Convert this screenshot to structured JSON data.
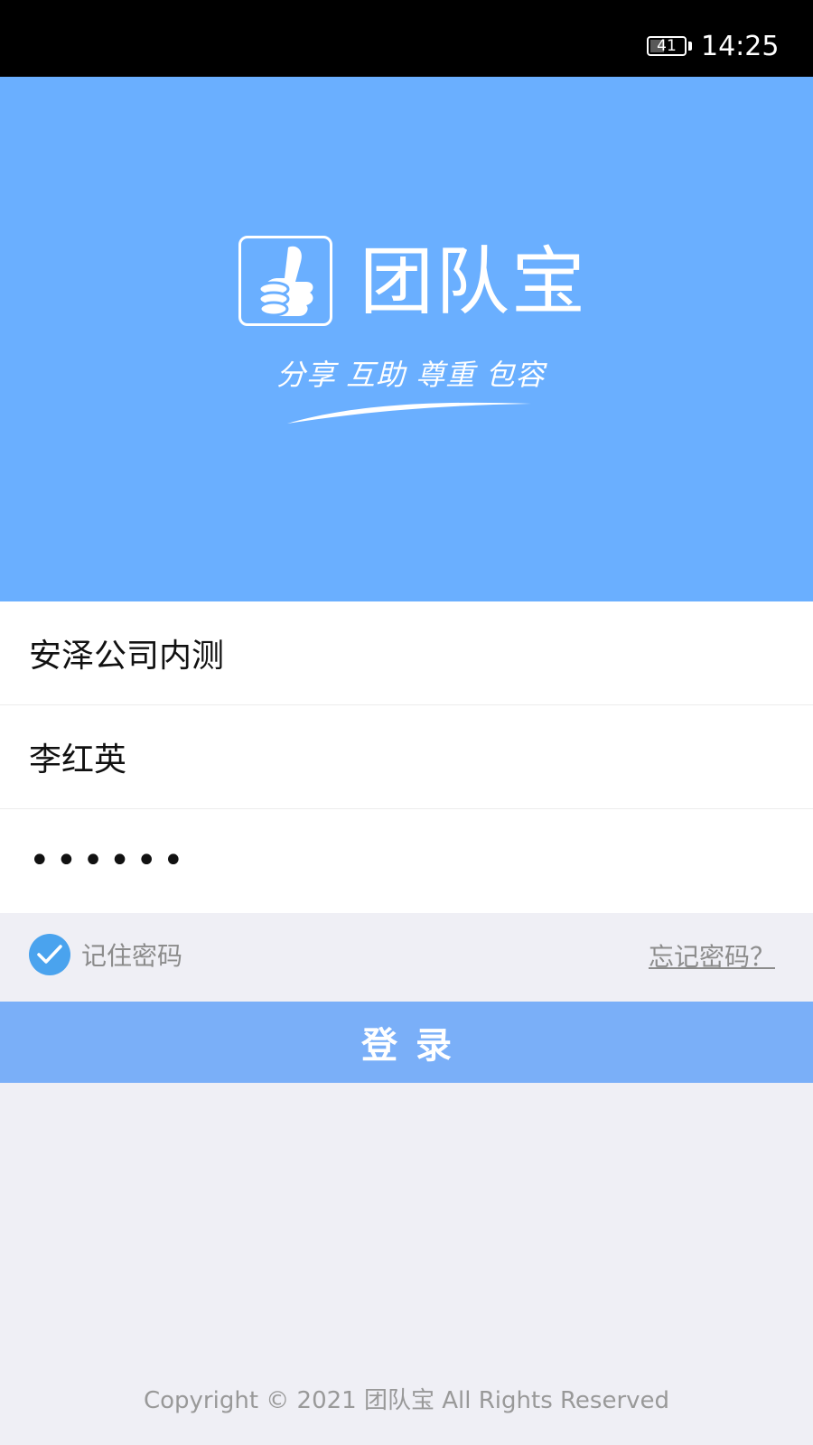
{
  "status_bar": {
    "battery": "41",
    "battery_level": 0.41,
    "time": "14:25"
  },
  "hero": {
    "brand_name": "团队宝",
    "slogan": "分享 互助 尊重 包容",
    "background_color": "#6aafff"
  },
  "form": {
    "company_value": "安泽公司内测",
    "username_value": "李红英",
    "password_mask": "••••••"
  },
  "options": {
    "remember_checked": true,
    "remember_label": "记住密码",
    "forgot_label": "忘记密码？"
  },
  "login": {
    "label": "登录",
    "color": "#7aaff8"
  },
  "footer": {
    "copyright": "Copyright © 2021 团队宝 All Rights Reserved"
  },
  "icons": {
    "battery": "battery-icon",
    "logo": "thumbs-up-icon",
    "check": "check-icon"
  }
}
